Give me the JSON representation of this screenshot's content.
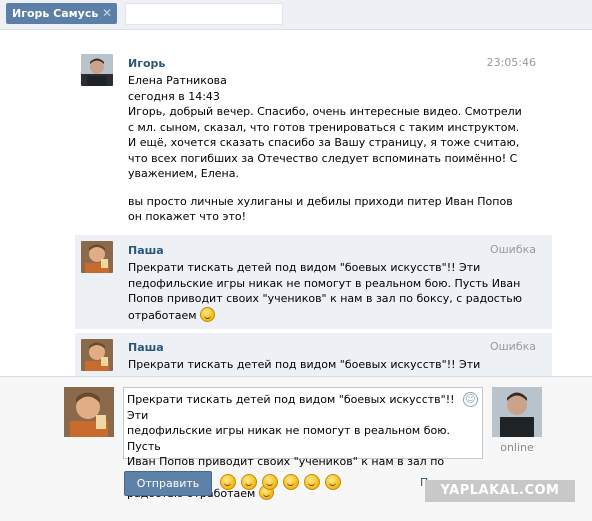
{
  "tab": {
    "label": "Игорь Самусь",
    "close": "✕"
  },
  "messages": [
    {
      "name": "Игорь",
      "time": "23:05:46",
      "lines": [
        "Елена Ратникова",
        "сегодня в 14:43",
        "Игорь, добрый вечер. Спасибо, очень интересные видео. Смотрели",
        "с мл. сыном, сказал, что готов тренироваться с таким инструктом.",
        "И ещё, хочется сказать спасибо за Вашу страницу, я тоже считаю,",
        "что всех погибших за Отечество следует вспоминать поимённо! С",
        "уважением, Елена."
      ],
      "lines2": [
        "вы просто личные хулиганы и дебилы приходи питер Иван Попов",
        "он покажет что это!"
      ]
    },
    {
      "name": "Паша",
      "time": "Ошибка",
      "lines": [
        "Прекрати тискать детей под видом \"боевых искусств\"!! Эти",
        "педофильские игры никак не помогут в реальном бою. Пусть Иван",
        "Попов приводит своих \"учеников\" к нам в зал по боксу, с радостью",
        "отработаем"
      ]
    },
    {
      "name": "Паша",
      "time": "Ошибка",
      "lines": [
        "Прекрати тискать детей под видом \"боевых искусств\"!! Эти"
      ]
    }
  ],
  "compose": {
    "lines": [
      "Прекрати тискать детей под видом \"боевых искусств\"!! Эти",
      "педофильские игры никак не помогут в реальном бою. Пусть",
      "Иван Попов приводит своих \"учеников\" к нам в зал по боксу, с",
      "радостью отработаем"
    ],
    "send_label": "Отправить",
    "attach_label": "Прикрепить",
    "online_label": "online"
  },
  "watermark": "YAPLAKAL.COM",
  "colors": {
    "accent": "#2b587a",
    "button": "#5e81a8",
    "highlight": "#edf1f5"
  }
}
